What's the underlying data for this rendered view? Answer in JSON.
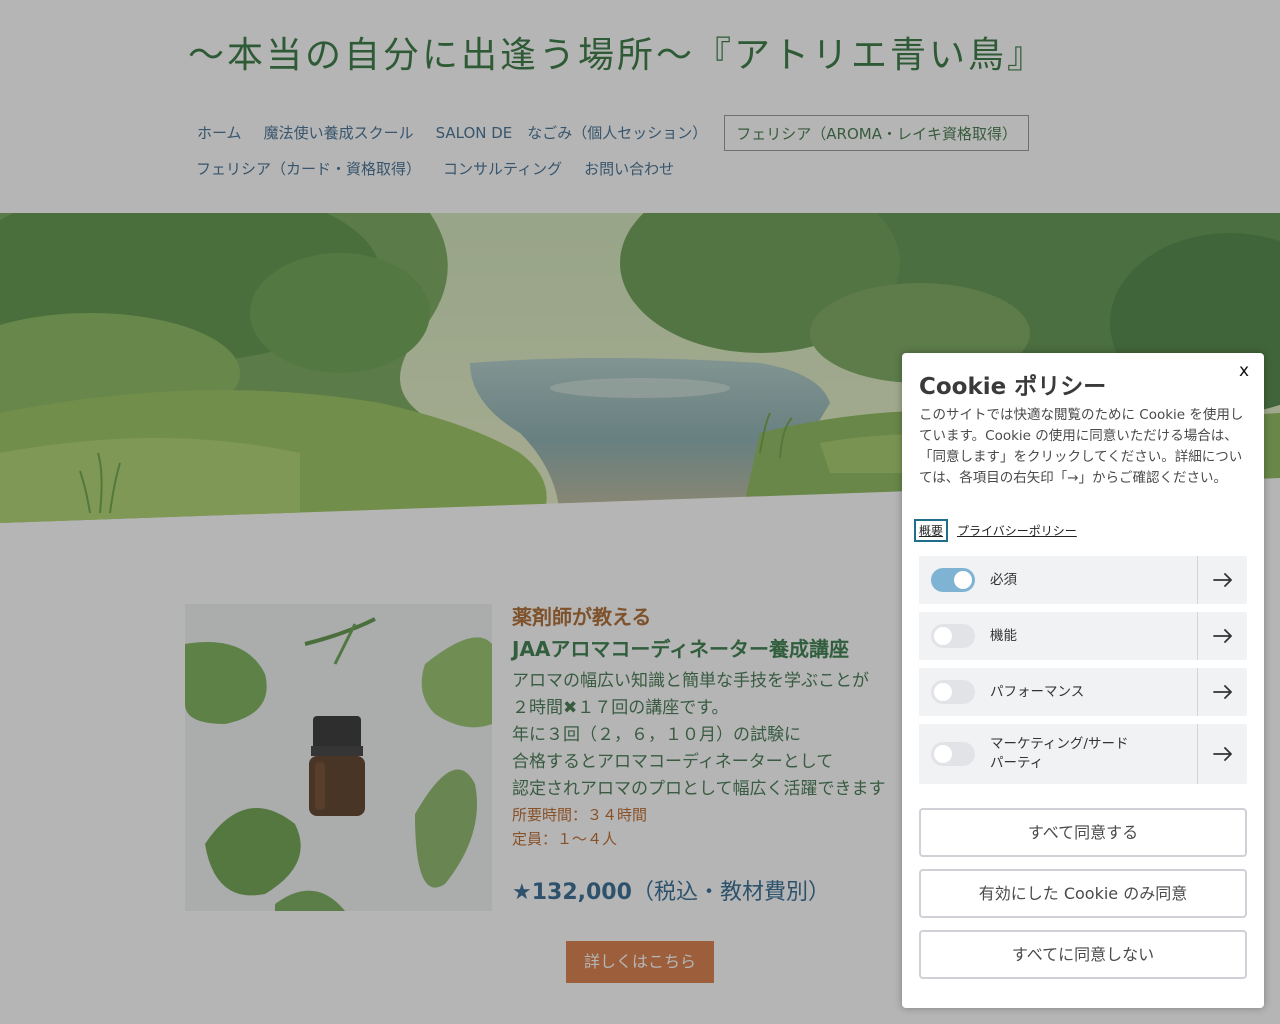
{
  "site": {
    "title": "〜本当の自分に出逢う場所〜『アトリエ青い鳥』"
  },
  "nav": {
    "row1": [
      "ホーム",
      "魔法使い養成スクール",
      "SALON DE　なごみ（個人セッション）",
      "フェリシア（AROMA・レイキ資格取得）"
    ],
    "row2": [
      "フェリシア（カード・資格取得）",
      "コンサルティング",
      "お問い合わせ"
    ],
    "active": "フェリシア（AROMA・レイキ資格取得）"
  },
  "course": {
    "kicker": "薬剤師が教える",
    "title": "JAAアロマコーディネーター養成講座",
    "body": [
      "アロマの幅広い知識と簡単な手技を学ぶことが",
      "２時間✖１７回の講座です。",
      "年に３回（２，６，１０月）の試験に",
      "合格するとアロマコーディネーターとして",
      "認定されアロマのプロとして幅広く活躍できます"
    ],
    "duration": "所要時間：３４時間",
    "capacity": "定員：１〜４人",
    "price_main": "★132,000",
    "price_note": "（税込・教材費別）",
    "details_label": "詳しくはこちら"
  },
  "cookie": {
    "close": "x",
    "title": "Cookie ポリシー",
    "description": "このサイトでは快適な閲覧のために Cookie を使用しています。Cookie の使用に同意いただける場合は、「同意します」をクリックしてください。詳細については、各項目の右矢印「→」からご確認ください。",
    "link_overview": "概要",
    "link_privacy": "プライバシーポリシー",
    "categories": [
      {
        "label": "必須",
        "enabled": true
      },
      {
        "label": "機能",
        "enabled": false
      },
      {
        "label": "パフォーマンス",
        "enabled": false
      },
      {
        "label": "マーケティング/サードパーティ",
        "enabled": false
      }
    ],
    "accept_all": "すべて同意する",
    "accept_selected": "有効にした Cookie のみ同意",
    "reject_all": "すべてに同意しない"
  },
  "colors": {
    "title_green": "#1f6a2c",
    "nav_blue": "#2f5f86",
    "button_orange": "#d66f34",
    "toggle_on": "#7fb3d3"
  }
}
